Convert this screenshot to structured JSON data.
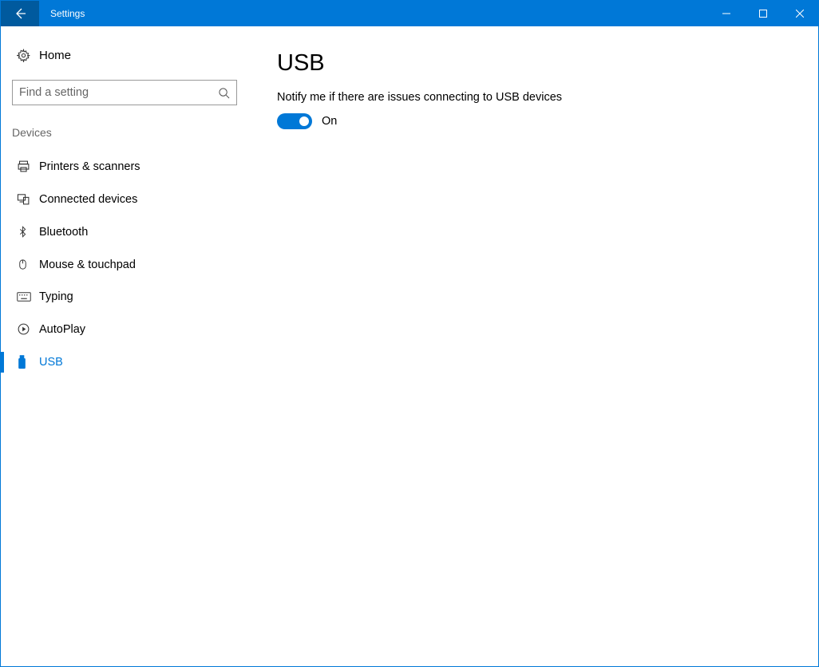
{
  "titlebar": {
    "title": "Settings"
  },
  "sidebar": {
    "home_label": "Home",
    "search_placeholder": "Find a setting",
    "section_label": "Devices",
    "items": [
      {
        "label": "Printers & scanners"
      },
      {
        "label": "Connected devices"
      },
      {
        "label": "Bluetooth"
      },
      {
        "label": "Mouse & touchpad"
      },
      {
        "label": "Typing"
      },
      {
        "label": "AutoPlay"
      },
      {
        "label": "USB"
      }
    ]
  },
  "main": {
    "page_title": "USB",
    "setting_desc": "Notify me if there are issues connecting to USB devices",
    "toggle_state_label": "On"
  }
}
